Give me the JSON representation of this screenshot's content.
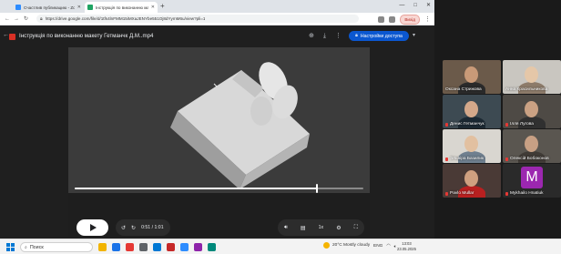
{
  "browser": {
    "tabs": [
      {
        "label": "Счастлив публикацию - Zoom",
        "icon_color": "#2d8cff"
      },
      {
        "label": "Інструкція по виконанню макет",
        "icon_color": "#1fa463"
      }
    ],
    "new_tab": "+",
    "url": "https://drive.google.com/file/d/1tfs4lnFMM15iMXaJENYbe551Oj8dYymM6u/view?pli=1",
    "profile": "Вихід",
    "controls": {
      "minimize": "—",
      "maximize": "□",
      "close": "✕"
    }
  },
  "viewer": {
    "file_title": "Інструкція по виконанню макету Гетманчк Д.М..mp4",
    "share_label": "Настройки доступа",
    "current_time": "0:51",
    "duration": "1:01",
    "time_display": "0:51 / 1:01",
    "speed": "1x",
    "progress": 0.84
  },
  "zoom": {
    "participants": [
      {
        "name": "Оксана Стрижова",
        "bg": "#6b5a4a",
        "skin": "#c99a78",
        "shirt": "#2a2a2a",
        "muted": false
      },
      {
        "name": "Анна Красильникова",
        "bg": "#c9c6c0",
        "skin": "#e5c7a8",
        "shirt": "#8d7b6a",
        "muted": false
      },
      {
        "name": "Денис Гетманчук",
        "bg": "#3d4a52",
        "skin": "#d4a88a",
        "shirt": "#1c2933",
        "muted": true
      },
      {
        "name": "Ілля Лугова",
        "bg": "#4e4a45",
        "skin": "#caa183",
        "shirt": "#303030",
        "muted": true
      },
      {
        "name": "Эльвіра Базилик",
        "bg": "#d9d6d0",
        "skin": "#e2c0a0",
        "shirt": "#6f7f8f",
        "muted": true
      },
      {
        "name": "Олексій Бобоконов",
        "bg": "#5a5650",
        "skin": "#c8a084",
        "shirt": "#403b36",
        "muted": true
      },
      {
        "name": "Pavlo Mullar",
        "bg": "#4a3a36",
        "skin": "#cfa080",
        "shirt": "#b82020",
        "muted": true
      },
      {
        "name": "Mykhailo Hnatiuk",
        "bg": "#2a2a2a",
        "initial": "M",
        "tile_color": "#9c27b0",
        "muted": true
      }
    ]
  },
  "taskbar": {
    "search_label": "Поиск",
    "weather": "20°C  Mostly cloudy",
    "tray_lang": "ENG",
    "time": "13:03",
    "date": "23.05.2025",
    "apps": [
      "#f2b400",
      "#1a73e8",
      "#e53935",
      "#5f6368",
      "#0078d4",
      "#c62828",
      "#2d8cff",
      "#8e24aa",
      "#00897b"
    ]
  }
}
